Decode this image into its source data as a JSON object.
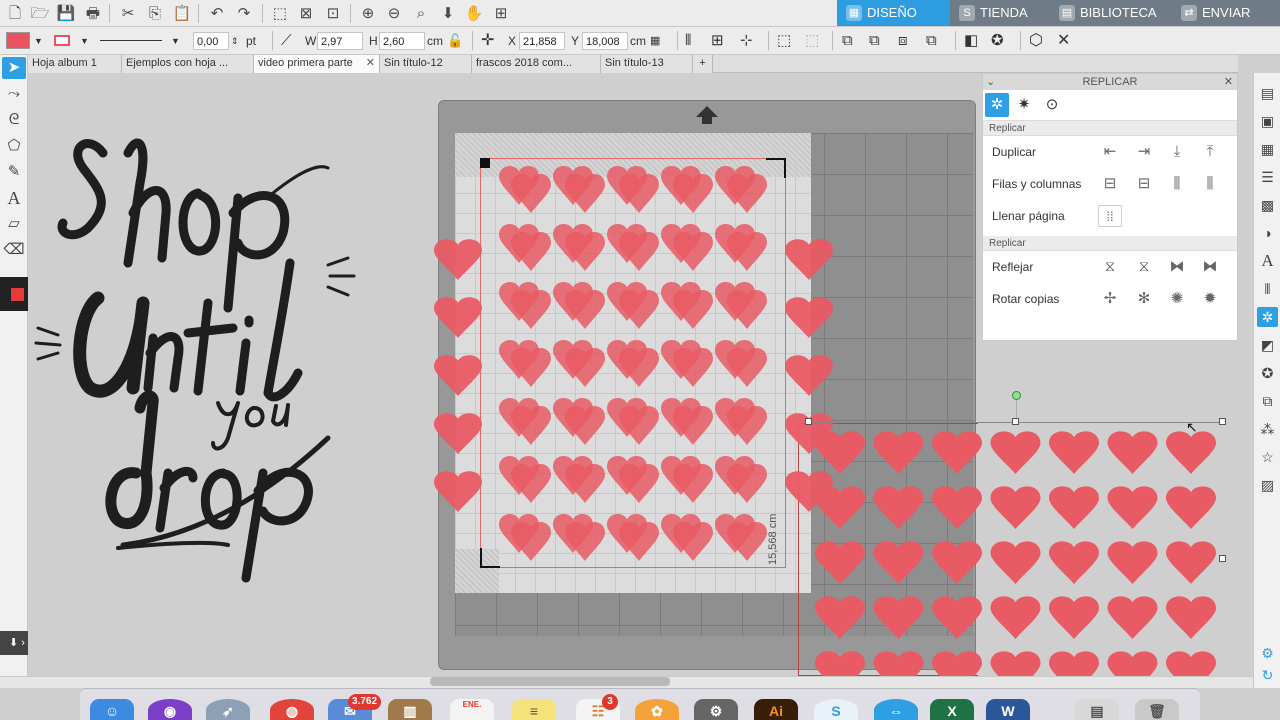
{
  "top_nav": {
    "diseno": "DISEÑO",
    "tienda": "TIENDA",
    "biblioteca": "BIBLIOTECA",
    "enviar": "ENVIAR"
  },
  "toolbar2": {
    "line_width": "0,00",
    "line_unit": "pt",
    "w_label": "W",
    "w_value": "2,97",
    "h_label": "H",
    "h_value": "2,60",
    "size_unit": "cm",
    "x_label": "X",
    "x_value": "21,858",
    "y_label": "Y",
    "y_value": "18,008",
    "pos_unit": "cm",
    "fill_color": "#e8535f",
    "line_color": "#e8535f"
  },
  "tabs": [
    {
      "label": "Hoja album 1"
    },
    {
      "label": "Ejemplos con hoja ..."
    },
    {
      "label": "video primera parte"
    },
    {
      "label": "Sin título-12"
    },
    {
      "label": "frascos 2018 com..."
    },
    {
      "label": "Sin título-13"
    },
    {
      "label": "+"
    }
  ],
  "canvas": {
    "lettering_alt": "Shop Until you drop",
    "dimension_label": "15,568 cm",
    "heart_color": "#e85a64"
  },
  "panel": {
    "title": "REPLICAR",
    "section1": "Replicar",
    "section2": "Replicar",
    "rows": [
      {
        "label": "Duplicar"
      },
      {
        "label": "Filas y columnas"
      },
      {
        "label": "Llenar página"
      },
      {
        "label": "Reflejar"
      },
      {
        "label": "Rotar copias"
      }
    ]
  },
  "dock": {
    "badge_mail": "3.762",
    "badge_reminders": "3",
    "calendar_month": "ENE."
  },
  "icons": {
    "new": "new-file-icon",
    "open": "open-folder-icon",
    "save": "save-icon",
    "print": "print-icon",
    "cut": "scissors-icon",
    "copy": "copy-icon",
    "paste": "paste-icon",
    "undo": "undo-icon",
    "redo": "redo-icon"
  }
}
